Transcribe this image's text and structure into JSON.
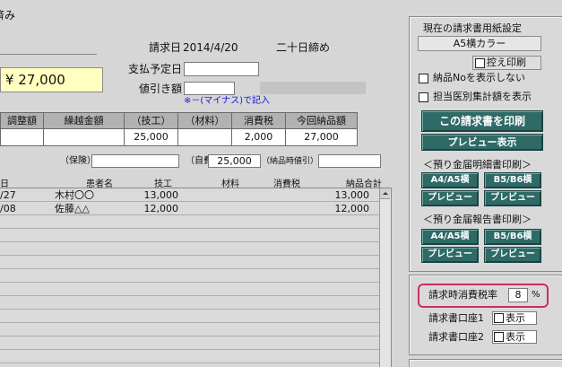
{
  "colors": {
    "background": "#d6d6d6",
    "total_bg": "#ffffc0",
    "button_teal": "#2e6a66",
    "note_blue": "#1a1ad0",
    "tax_highlight": "#c8305a"
  },
  "header": {
    "status_fragment": "済み",
    "invoice_date_label": "請求日",
    "invoice_date": "2014/4/20",
    "closing": "二十日締め"
  },
  "total": {
    "amount": "¥ 27,000"
  },
  "payment": {
    "label": "支払予定日",
    "value": ""
  },
  "discount": {
    "label": "値引き額",
    "value": "",
    "note": "※－(マイナス)で記入"
  },
  "summary": {
    "headers": [
      "調整額",
      "繰越金額",
      "（技工）",
      "（材料）",
      "消費税",
      "今回納品額"
    ],
    "values": [
      "",
      "",
      "25,000",
      "",
      "2,000",
      "27,000"
    ]
  },
  "extras": {
    "insurance_label": "（保険）",
    "insurance_value": "",
    "self_pay_label": "（自費）",
    "self_pay_value": "25,000",
    "delivery_discount_label": "（納品時値引）",
    "delivery_discount_value": ""
  },
  "list": {
    "headers": [
      "日",
      "患者名",
      "技工",
      "材料",
      "消費税",
      "納品合計"
    ],
    "rows": [
      {
        "date": "/27",
        "patient": "木村〇〇",
        "tech": "13,000",
        "material": "",
        "tax": "",
        "total": "13,000"
      },
      {
        "date": "/08",
        "patient": "佐藤△△",
        "tech": "12,000",
        "material": "",
        "tax": "",
        "total": "12,000"
      }
    ]
  },
  "print_panel": {
    "paper_setting_label": "現在の請求書用紙設定",
    "paper_setting_value": "A5横カラー",
    "copy_print_label": "控え印刷",
    "copy_print_checked": false,
    "hide_delivery_no_label": "納品Noを表示しない",
    "hide_delivery_no_checked": false,
    "doctor_total_label": "担当医別集計額を表示",
    "doctor_total_checked": false,
    "print_button": "この請求書を印刷",
    "preview_button": "プレビュー表示",
    "deposit_detail_label": "＜預り金届明細書印刷＞",
    "deposit_report_label": "＜預り金届報告書印刷＞",
    "a4a5_label": "A4/A5横",
    "b5b6_label": "B5/B6横",
    "preview_short": "プレビュー"
  },
  "tax_panel": {
    "rate_label": "請求時消費税率",
    "rate_value": "8",
    "rate_unit": "%",
    "account1_label": "請求書口座1",
    "account2_label": "請求書口座2",
    "show_label": "表示",
    "account1_checked": false,
    "account2_checked": false
  }
}
